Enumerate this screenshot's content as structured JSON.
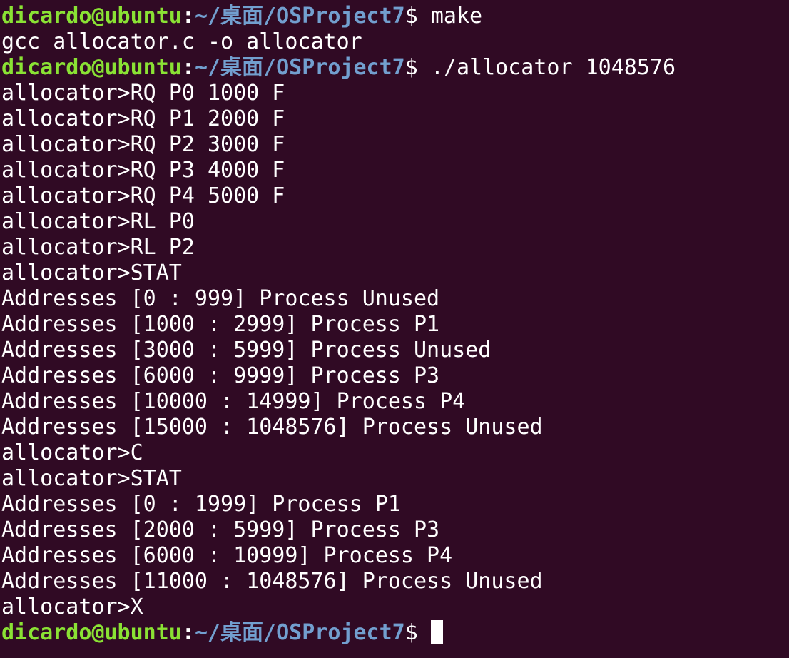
{
  "terminal": {
    "prompt": {
      "user_host": "dicardo@ubuntu",
      "colon": ":",
      "path": "~/桌面/OSProject7",
      "dollar": "$ "
    },
    "colors": {
      "background": "#300a24",
      "user": "#8ae234",
      "path": "#729fcf",
      "text": "#ffffff"
    },
    "lines": [
      {
        "type": "prompt",
        "cmd": "make"
      },
      {
        "type": "output",
        "text": "gcc allocator.c -o allocator"
      },
      {
        "type": "prompt",
        "cmd": "./allocator 1048576"
      },
      {
        "type": "output",
        "text": "allocator>RQ P0 1000 F"
      },
      {
        "type": "output",
        "text": "allocator>RQ P1 2000 F"
      },
      {
        "type": "output",
        "text": "allocator>RQ P2 3000 F"
      },
      {
        "type": "output",
        "text": "allocator>RQ P3 4000 F"
      },
      {
        "type": "output",
        "text": "allocator>RQ P4 5000 F"
      },
      {
        "type": "output",
        "text": "allocator>RL P0"
      },
      {
        "type": "output",
        "text": "allocator>RL P2"
      },
      {
        "type": "output",
        "text": "allocator>STAT"
      },
      {
        "type": "output",
        "text": "Addresses [0 : 999] Process Unused"
      },
      {
        "type": "output",
        "text": "Addresses [1000 : 2999] Process P1"
      },
      {
        "type": "output",
        "text": "Addresses [3000 : 5999] Process Unused"
      },
      {
        "type": "output",
        "text": "Addresses [6000 : 9999] Process P3"
      },
      {
        "type": "output",
        "text": "Addresses [10000 : 14999] Process P4"
      },
      {
        "type": "output",
        "text": "Addresses [15000 : 1048576] Process Unused"
      },
      {
        "type": "output",
        "text": "allocator>C"
      },
      {
        "type": "output",
        "text": "allocator>STAT"
      },
      {
        "type": "output",
        "text": "Addresses [0 : 1999] Process P1"
      },
      {
        "type": "output",
        "text": "Addresses [2000 : 5999] Process P3"
      },
      {
        "type": "output",
        "text": "Addresses [6000 : 10999] Process P4"
      },
      {
        "type": "output",
        "text": "Addresses [11000 : 1048576] Process Unused"
      },
      {
        "type": "output",
        "text": "allocator>X"
      },
      {
        "type": "prompt",
        "cmd": "",
        "cursor": true
      }
    ]
  }
}
